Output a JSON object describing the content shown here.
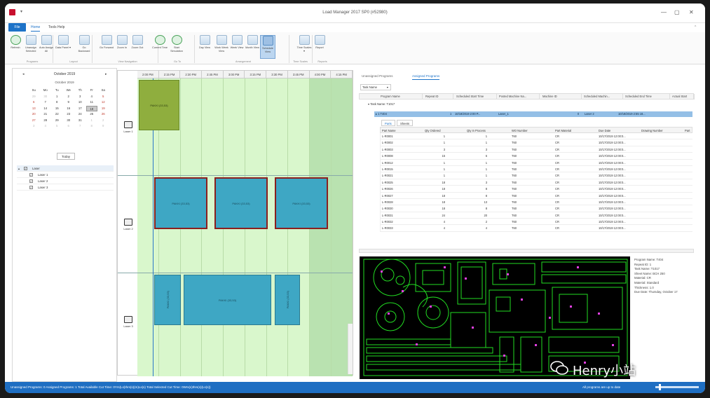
{
  "window": {
    "title": "Load Manager 2017 SP0 (#52980)",
    "qa": "▾",
    "minimize": "—",
    "maximize": "▢",
    "close": "✕",
    "collapse": "^"
  },
  "menu": {
    "file": "File",
    "tabs": [
      "Home",
      "Tools Help"
    ]
  },
  "ribbon": {
    "buttons": [
      {
        "label": "Refresh",
        "icon": "refresh-icon"
      },
      {
        "label": "Unassign Selected",
        "icon": "undo-icon"
      },
      {
        "label": "Auto Assign All",
        "icon": "auto-assign-icon"
      },
      {
        "label": "Data Panel ▾",
        "icon": "data-panel-icon"
      },
      {
        "label": "Go Backward",
        "icon": "go-backward-icon"
      },
      {
        "label": "Go Forward",
        "icon": "go-forward-icon"
      },
      {
        "label": "Zoom In",
        "icon": "zoom-in-icon"
      },
      {
        "label": "Zoom Out",
        "icon": "zoom-out-icon"
      },
      {
        "label": "Current Time",
        "icon": "clock-icon"
      },
      {
        "label": "Start Simulation",
        "icon": "simulation-icon"
      },
      {
        "label": "Day View",
        "icon": "day-view-icon"
      },
      {
        "label": "Work Week View",
        "icon": "work-week-icon"
      },
      {
        "label": "Week View",
        "icon": "week-view-icon"
      },
      {
        "label": "Month View",
        "icon": "month-view-icon"
      },
      {
        "label": "Schedule View",
        "icon": "schedule-view-icon"
      },
      {
        "label": "Time Scales ▾",
        "icon": "time-scales-icon"
      },
      {
        "label": "Report",
        "icon": "report-icon"
      }
    ],
    "groups": [
      "Programs",
      "Layout",
      "View Navigation",
      "Go To",
      "Arrangement",
      "Time Scales",
      "Reports"
    ]
  },
  "calendar": {
    "nav_prev": "◂",
    "nav_next": "▸",
    "header": "October 2019",
    "month_title": "October 2019",
    "weekdays": [
      "Su",
      "Mo",
      "Tu",
      "We",
      "Th",
      "Fr",
      "Sa"
    ],
    "weeks": [
      [
        "29",
        "30",
        "1",
        "2",
        "3",
        "4",
        "5"
      ],
      [
        "6",
        "7",
        "8",
        "9",
        "10",
        "11",
        "12"
      ],
      [
        "13",
        "14",
        "15",
        "16",
        "17",
        "18",
        "19"
      ],
      [
        "20",
        "21",
        "22",
        "23",
        "24",
        "25",
        "26"
      ],
      [
        "27",
        "28",
        "29",
        "30",
        "31",
        "1",
        "2"
      ],
      [
        "3",
        "4",
        "5",
        "6",
        "7",
        "8",
        "9"
      ]
    ],
    "selected_day": "18",
    "today_button": "Today"
  },
  "laser_tree": {
    "header": "Laser",
    "items": [
      "Laser 1",
      "Laser 2",
      "Laser 3"
    ]
  },
  "gantt": {
    "times": [
      "2:00 PM",
      "2:15 PM",
      "2:30 PM",
      "2:45 PM",
      "3:00 PM",
      "3:15 PM",
      "3:30 PM",
      "3:45 PM",
      "4:00 PM",
      "4:15 PM"
    ],
    "lanes": [
      "Laser 1",
      "Laser 2",
      "Laser 3"
    ],
    "block_label": "PAKKI (33,53)"
  },
  "right": {
    "tabs": [
      "Unassigned Programs",
      "Assigned Programs"
    ],
    "filter": "Task Name",
    "filter_caret": "▾",
    "columns": [
      "Program Name",
      "Repeat ID",
      "Scheduled Start Time",
      "Posted Machine Na...",
      "Machine ID",
      "Scheduled Machin...",
      "Scheduled End Time",
      "Actual Start"
    ],
    "group_row": "▾ Task Name: T1017",
    "selected": {
      "program": "▸ 1 T404",
      "repeat": "1",
      "start": "10/18/2019 2:00 P...",
      "posted": "Laser_1",
      "machine": "0",
      "sched_machine": "Laser 2",
      "end": "10/18/2019 2:55 18..."
    },
    "subtabs": [
      "Parts",
      "Sheets"
    ],
    "parts_columns": [
      "Part Name",
      "Qty Ordered",
      "Qty In Process",
      "WO Number",
      "Part Material",
      "Due Date",
      "Drawing Number",
      "Part"
    ],
    "parts": [
      [
        "L-R0001",
        "1",
        "1",
        "T60",
        "CR",
        "10/17/2019 12:00:0..."
      ],
      [
        "L-R0002",
        "1",
        "1",
        "T60",
        "CR",
        "10/17/2019 12:00:0..."
      ],
      [
        "L-R0003",
        "3",
        "3",
        "T60",
        "CR",
        "10/17/2019 12:00:0..."
      ],
      [
        "L-R0008",
        "15",
        "6",
        "T60",
        "CR",
        "10/17/2019 12:00:0..."
      ],
      [
        "L-R0012",
        "1",
        "1",
        "T60",
        "CR",
        "10/17/2019 12:00:0..."
      ],
      [
        "L-R0015",
        "1",
        "1",
        "T60",
        "CR",
        "10/17/2019 12:00:0..."
      ],
      [
        "L-R0021",
        "1",
        "1",
        "T60",
        "CR",
        "10/17/2019 12:00:0..."
      ],
      [
        "L-R0025",
        "18",
        "3",
        "T60",
        "CR",
        "10/17/2019 12:00:0..."
      ],
      [
        "L-R0026",
        "18",
        "8",
        "T60",
        "CR",
        "10/17/2019 12:00:0..."
      ],
      [
        "L-R0027",
        "18",
        "8",
        "T60",
        "CR",
        "10/17/2019 12:00:0..."
      ],
      [
        "L-R0028",
        "18",
        "13",
        "T60",
        "CR",
        "10/17/2019 12:00:0..."
      ],
      [
        "L-R0030",
        "18",
        "8",
        "T60",
        "CR",
        "10/17/2019 12:00:0..."
      ],
      [
        "L-R0031",
        "24",
        "20",
        "T60",
        "CR",
        "10/17/2019 12:00:0..."
      ],
      [
        "L-R0032",
        "4",
        "2",
        "T60",
        "CR",
        "10/17/2019 12:00:0..."
      ],
      [
        "L-R0033",
        "4",
        "4",
        "T60",
        "CR",
        "10/17/2019 12:00:0..."
      ]
    ],
    "info": [
      "Program Name: T404",
      "Repeat ID: 1",
      "Task Name: T1017",
      "Sheet Name: BCH 250",
      "Material: CR",
      "Material: Standard",
      "Thickness: 1.0",
      "Due Date: Thursday, October 17"
    ]
  },
  "status": {
    "left": "Unassigned Programs: 0    Assigned Programs: 1    Total Available Cut Time: 0Yrs(Ls)Ihrs(s)(m)Ls(s)    Total Selected Cut Time: 0Wrs(s)Ihrs(s)(Ls(s))",
    "right": "All programs are up to date"
  },
  "watermark": "Henry小站",
  "colors": {
    "accent": "#1e73c8",
    "lane": "#d9f7cc",
    "block": "#3ea7c4",
    "block_done": "#8fae3e",
    "cad_bg": "#000000",
    "cad_line": "#22dd22",
    "cad_mark": "#e040e0"
  }
}
